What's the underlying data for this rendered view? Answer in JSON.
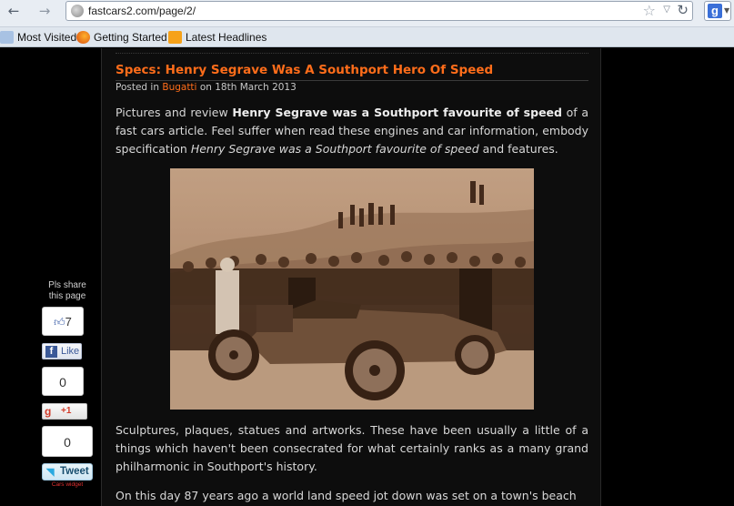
{
  "browser": {
    "url": "fastcars2.com/page/2/",
    "back_icon": "arrow-left-icon",
    "forward_icon": "arrow-right-icon",
    "search_engine_letter": "g",
    "bookmarks": [
      {
        "label": "Most Visited"
      },
      {
        "label": "Getting Started"
      },
      {
        "label": "Latest Headlines"
      }
    ]
  },
  "post": {
    "title": "Specs: Henry Segrave Was A Southport Hero Of Speed",
    "posted_in": "Posted in",
    "category": "Bugatti",
    "date_prefix": "on",
    "date": "18th March 2013",
    "p1_a": "Pictures and review ",
    "p1_b": "Henry Segrave was a Southport favourite of speed",
    "p1_c": " of a fast cars article. Feel suffer when read these engines and car information, embody specification ",
    "p1_d": "Henry Segrave was a Southport favourite of speed",
    "p1_e": " and features.",
    "p2": "Sculptures, plaques, statues and artworks. These have been usually a little of a things which haven't been consecrated for what certainly ranks as a many grand philharmonic in Southport's history.",
    "p3": "On this day 87 years ago a world land speed jot down was set on a town's beach"
  },
  "share": {
    "label_line1": "Pls share",
    "label_line2": "this page",
    "like_count": "7",
    "fb_like_label": "Like",
    "fb_count": "0",
    "gplus_label": "+1",
    "tweet_count": "0",
    "tweet_label": "Tweet",
    "widget_credit": "Cars widget"
  },
  "colors": {
    "accent": "#ff6d1a",
    "background": "#000000",
    "content_bg": "#0d0d0d",
    "text": "#d8d8d8"
  }
}
